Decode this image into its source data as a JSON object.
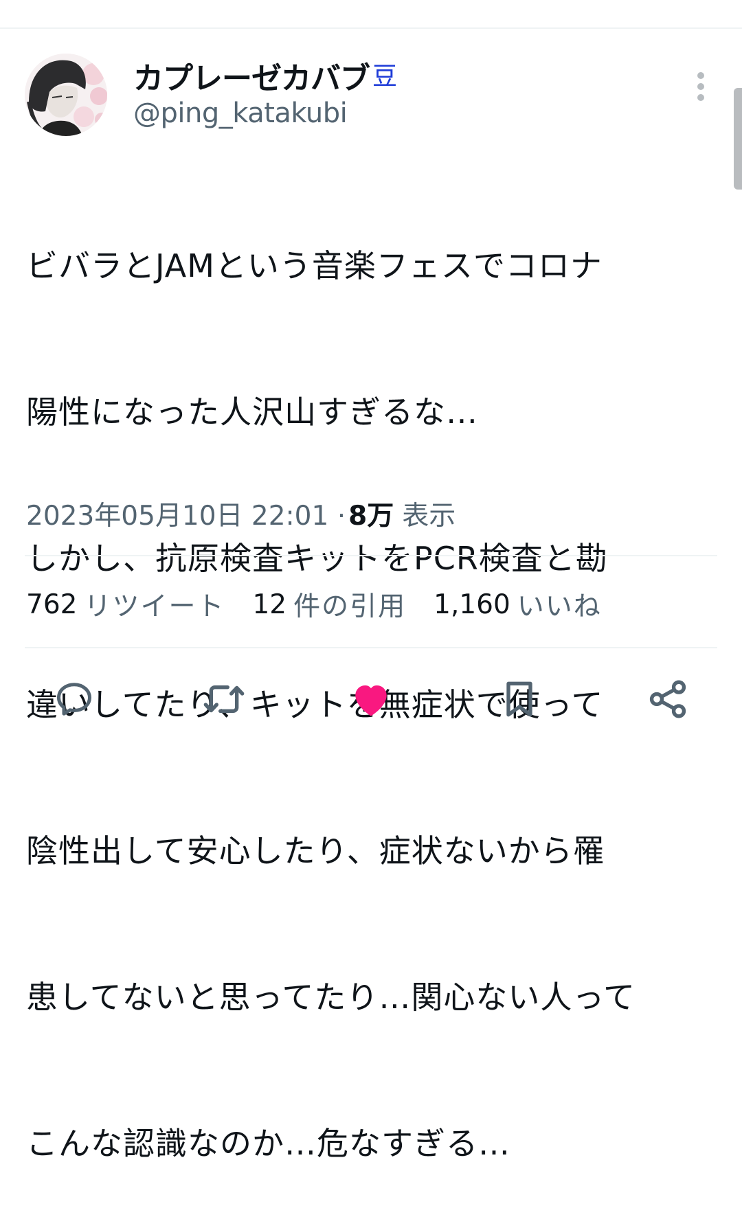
{
  "tweet": {
    "author": {
      "display_name": "カプレーゼカバブ",
      "badge": "豆",
      "handle": "@ping_katakubi"
    },
    "text_lines": [
      "ビバラとJAMという音楽フェスでコロナ",
      "陽性になった人沢山すぎるな…",
      "しかし、抗原検査キットをPCR検査と勘",
      "違いしてたり、キットを無症状で使って",
      "陰性出して安心したり、症状ないから罹",
      "患してないと思ってたり…関心ない人って",
      "こんな認識なのか…危なすぎる…"
    ],
    "timestamp": "2023年05月10日 22:01 ·",
    "views_count": "8万",
    "views_label": "表示"
  },
  "stats": {
    "retweets": {
      "count": "762",
      "label": "リツイート"
    },
    "quotes": {
      "count": "12",
      "label": "件の引用"
    },
    "likes": {
      "count": "1,160",
      "label": "いいね"
    }
  },
  "actions": [
    {
      "icon": "reply-icon"
    },
    {
      "icon": "retweet-icon"
    },
    {
      "icon": "like-icon",
      "active": true,
      "color": "#f91880"
    },
    {
      "icon": "bookmark-icon"
    },
    {
      "icon": "share-icon"
    }
  ],
  "colors": {
    "text_primary": "#0f1419",
    "text_secondary": "#536471",
    "divider": "#eff3f4",
    "like_active": "#f91880",
    "badge": "#1d3bd8"
  }
}
